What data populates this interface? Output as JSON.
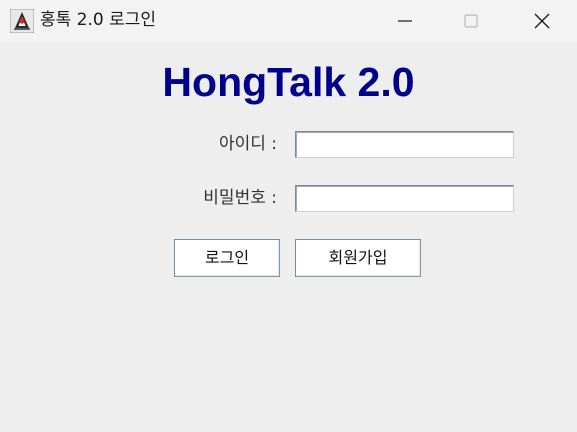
{
  "window": {
    "title": "홍톡 2.0 로그인",
    "icon": "java-duke-icon",
    "controls": [
      "minimize",
      "maximize",
      "close"
    ]
  },
  "app_title": "HongTalk 2.0",
  "form": {
    "id_label": "아이디 :",
    "id_value": "",
    "password_label": "비밀번호 :",
    "password_value": ""
  },
  "buttons": {
    "login": "로그인",
    "signup": "회원가입"
  },
  "colors": {
    "heading": "#00008b",
    "background": "#eeeeee"
  }
}
